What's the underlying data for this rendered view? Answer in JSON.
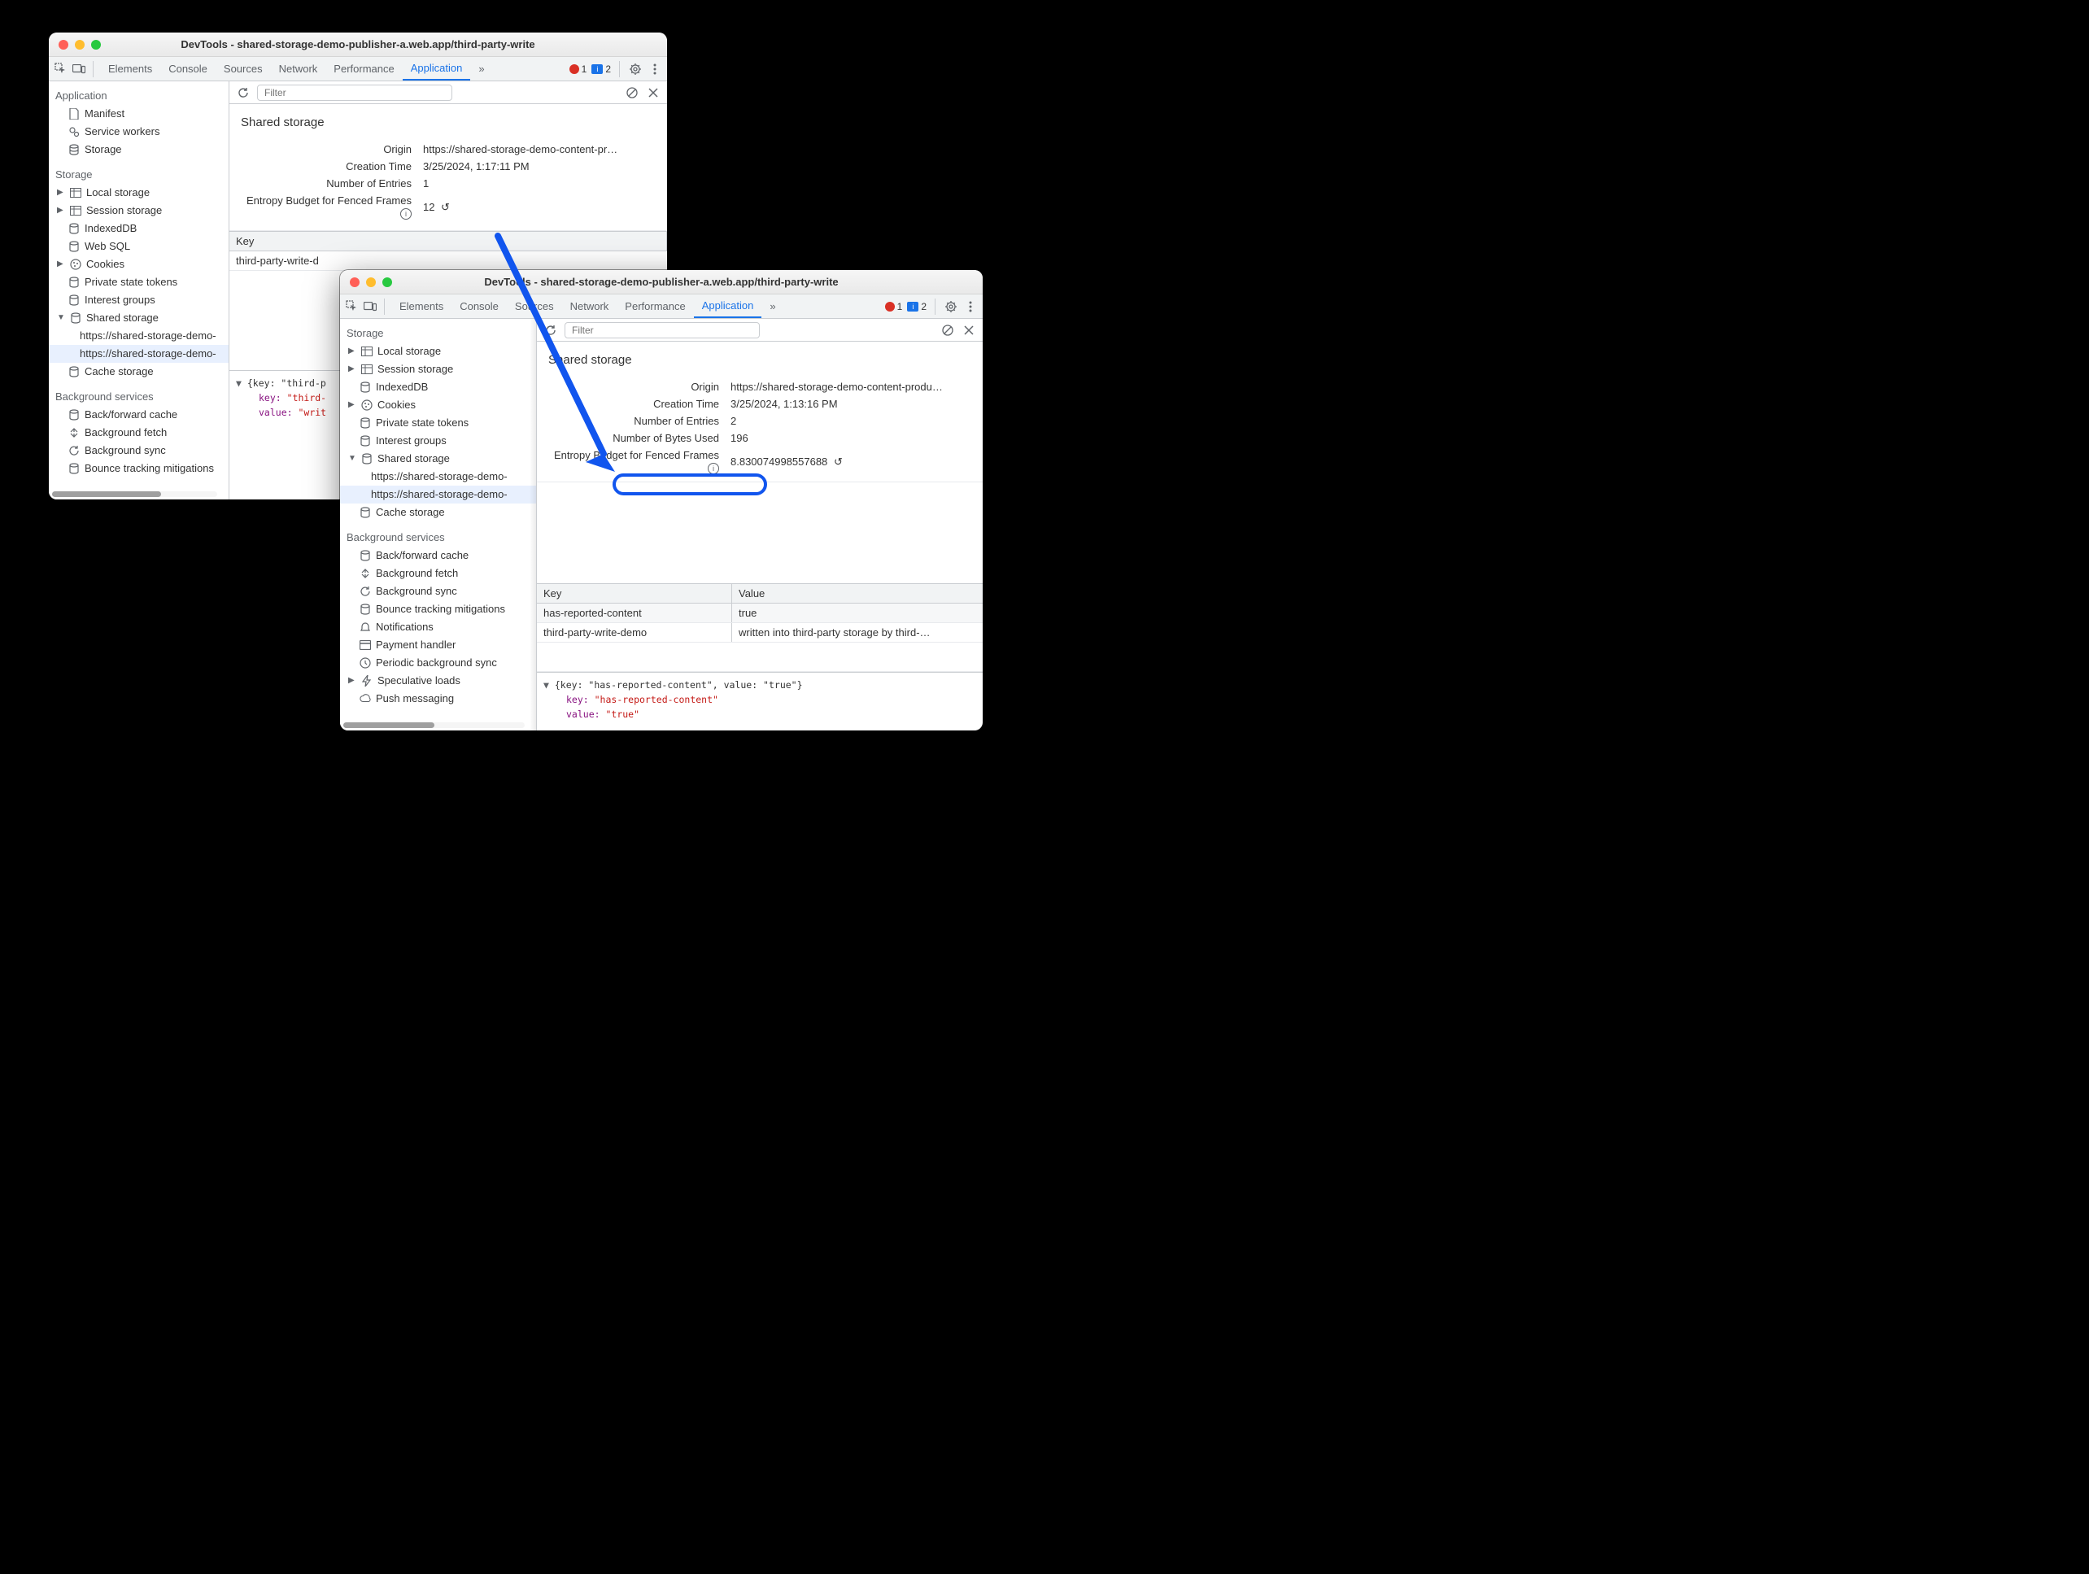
{
  "window_a": {
    "title": "DevTools - shared-storage-demo-publisher-a.web.app/third-party-write",
    "toolbar_tabs": [
      "Elements",
      "Console",
      "Sources",
      "Network",
      "Performance",
      "Application"
    ],
    "errors": "1",
    "info": "2",
    "filter_placeholder": "Filter",
    "sidebar": {
      "application_heading": "Application",
      "app_items": [
        "Manifest",
        "Service workers",
        "Storage"
      ],
      "storage_heading": "Storage",
      "storage_items": [
        "Local storage",
        "Session storage",
        "IndexedDB",
        "Web SQL",
        "Cookies",
        "Private state tokens",
        "Interest groups",
        "Shared storage"
      ],
      "shared_origins": [
        "https://shared-storage-demo-",
        "https://shared-storage-demo-"
      ],
      "cache_storage": "Cache storage",
      "bg_heading": "Background services",
      "bg_items": [
        "Back/forward cache",
        "Background fetch",
        "Background sync",
        "Bounce tracking mitigations"
      ]
    },
    "panel": {
      "title": "Shared storage",
      "origin_label": "Origin",
      "origin_value": "https://shared-storage-demo-content-pr…",
      "ctime_label": "Creation Time",
      "ctime_value": "3/25/2024, 1:17:11 PM",
      "entries_label": "Number of Entries",
      "entries_value": "1",
      "budget_label": "Entropy Budget for Fenced Frames",
      "budget_value": "12"
    },
    "table": {
      "key_header": "Key",
      "rows": [
        {
          "key": "third-party-write-d"
        }
      ]
    },
    "details": {
      "line1_open": "▼",
      "line1_text": "{key: \"third-p",
      "line2_k": "key: ",
      "line2_v": "\"third-",
      "line3_k": "value: ",
      "line3_v": "\"writ"
    }
  },
  "window_b": {
    "title": "DevTools - shared-storage-demo-publisher-a.web.app/third-party-write",
    "toolbar_tabs": [
      "Elements",
      "Console",
      "Sources",
      "Network",
      "Performance",
      "Application"
    ],
    "errors": "1",
    "info": "2",
    "filter_placeholder": "Filter",
    "sidebar": {
      "storage_heading": "Storage",
      "storage_items": [
        "Local storage",
        "Session storage",
        "IndexedDB",
        "Cookies",
        "Private state tokens",
        "Interest groups",
        "Shared storage"
      ],
      "shared_origins": [
        "https://shared-storage-demo-",
        "https://shared-storage-demo-"
      ],
      "cache_storage": "Cache storage",
      "bg_heading": "Background services",
      "bg_items": [
        "Back/forward cache",
        "Background fetch",
        "Background sync",
        "Bounce tracking mitigations",
        "Notifications",
        "Payment handler",
        "Periodic background sync",
        "Speculative loads",
        "Push messaging"
      ]
    },
    "panel": {
      "title": "Shared storage",
      "origin_label": "Origin",
      "origin_value": "https://shared-storage-demo-content-produ…",
      "ctime_label": "Creation Time",
      "ctime_value": "3/25/2024, 1:13:16 PM",
      "entries_label": "Number of Entries",
      "entries_value": "2",
      "bytes_label": "Number of Bytes Used",
      "bytes_value": "196",
      "budget_label": "Entropy Budget for Fenced Frames",
      "budget_value": "8.830074998557688"
    },
    "table": {
      "key_header": "Key",
      "value_header": "Value",
      "rows": [
        {
          "key": "has-reported-content",
          "value": "true"
        },
        {
          "key": "third-party-write-demo",
          "value": "written into third-party storage by third-…"
        }
      ]
    },
    "details": {
      "line1_open": "▼",
      "line1_text": "{key: \"has-reported-content\", value: \"true\"}",
      "line2_k": "key: ",
      "line2_v": "\"has-reported-content\"",
      "line3_k": "value: ",
      "line3_v": "\"true\""
    }
  }
}
